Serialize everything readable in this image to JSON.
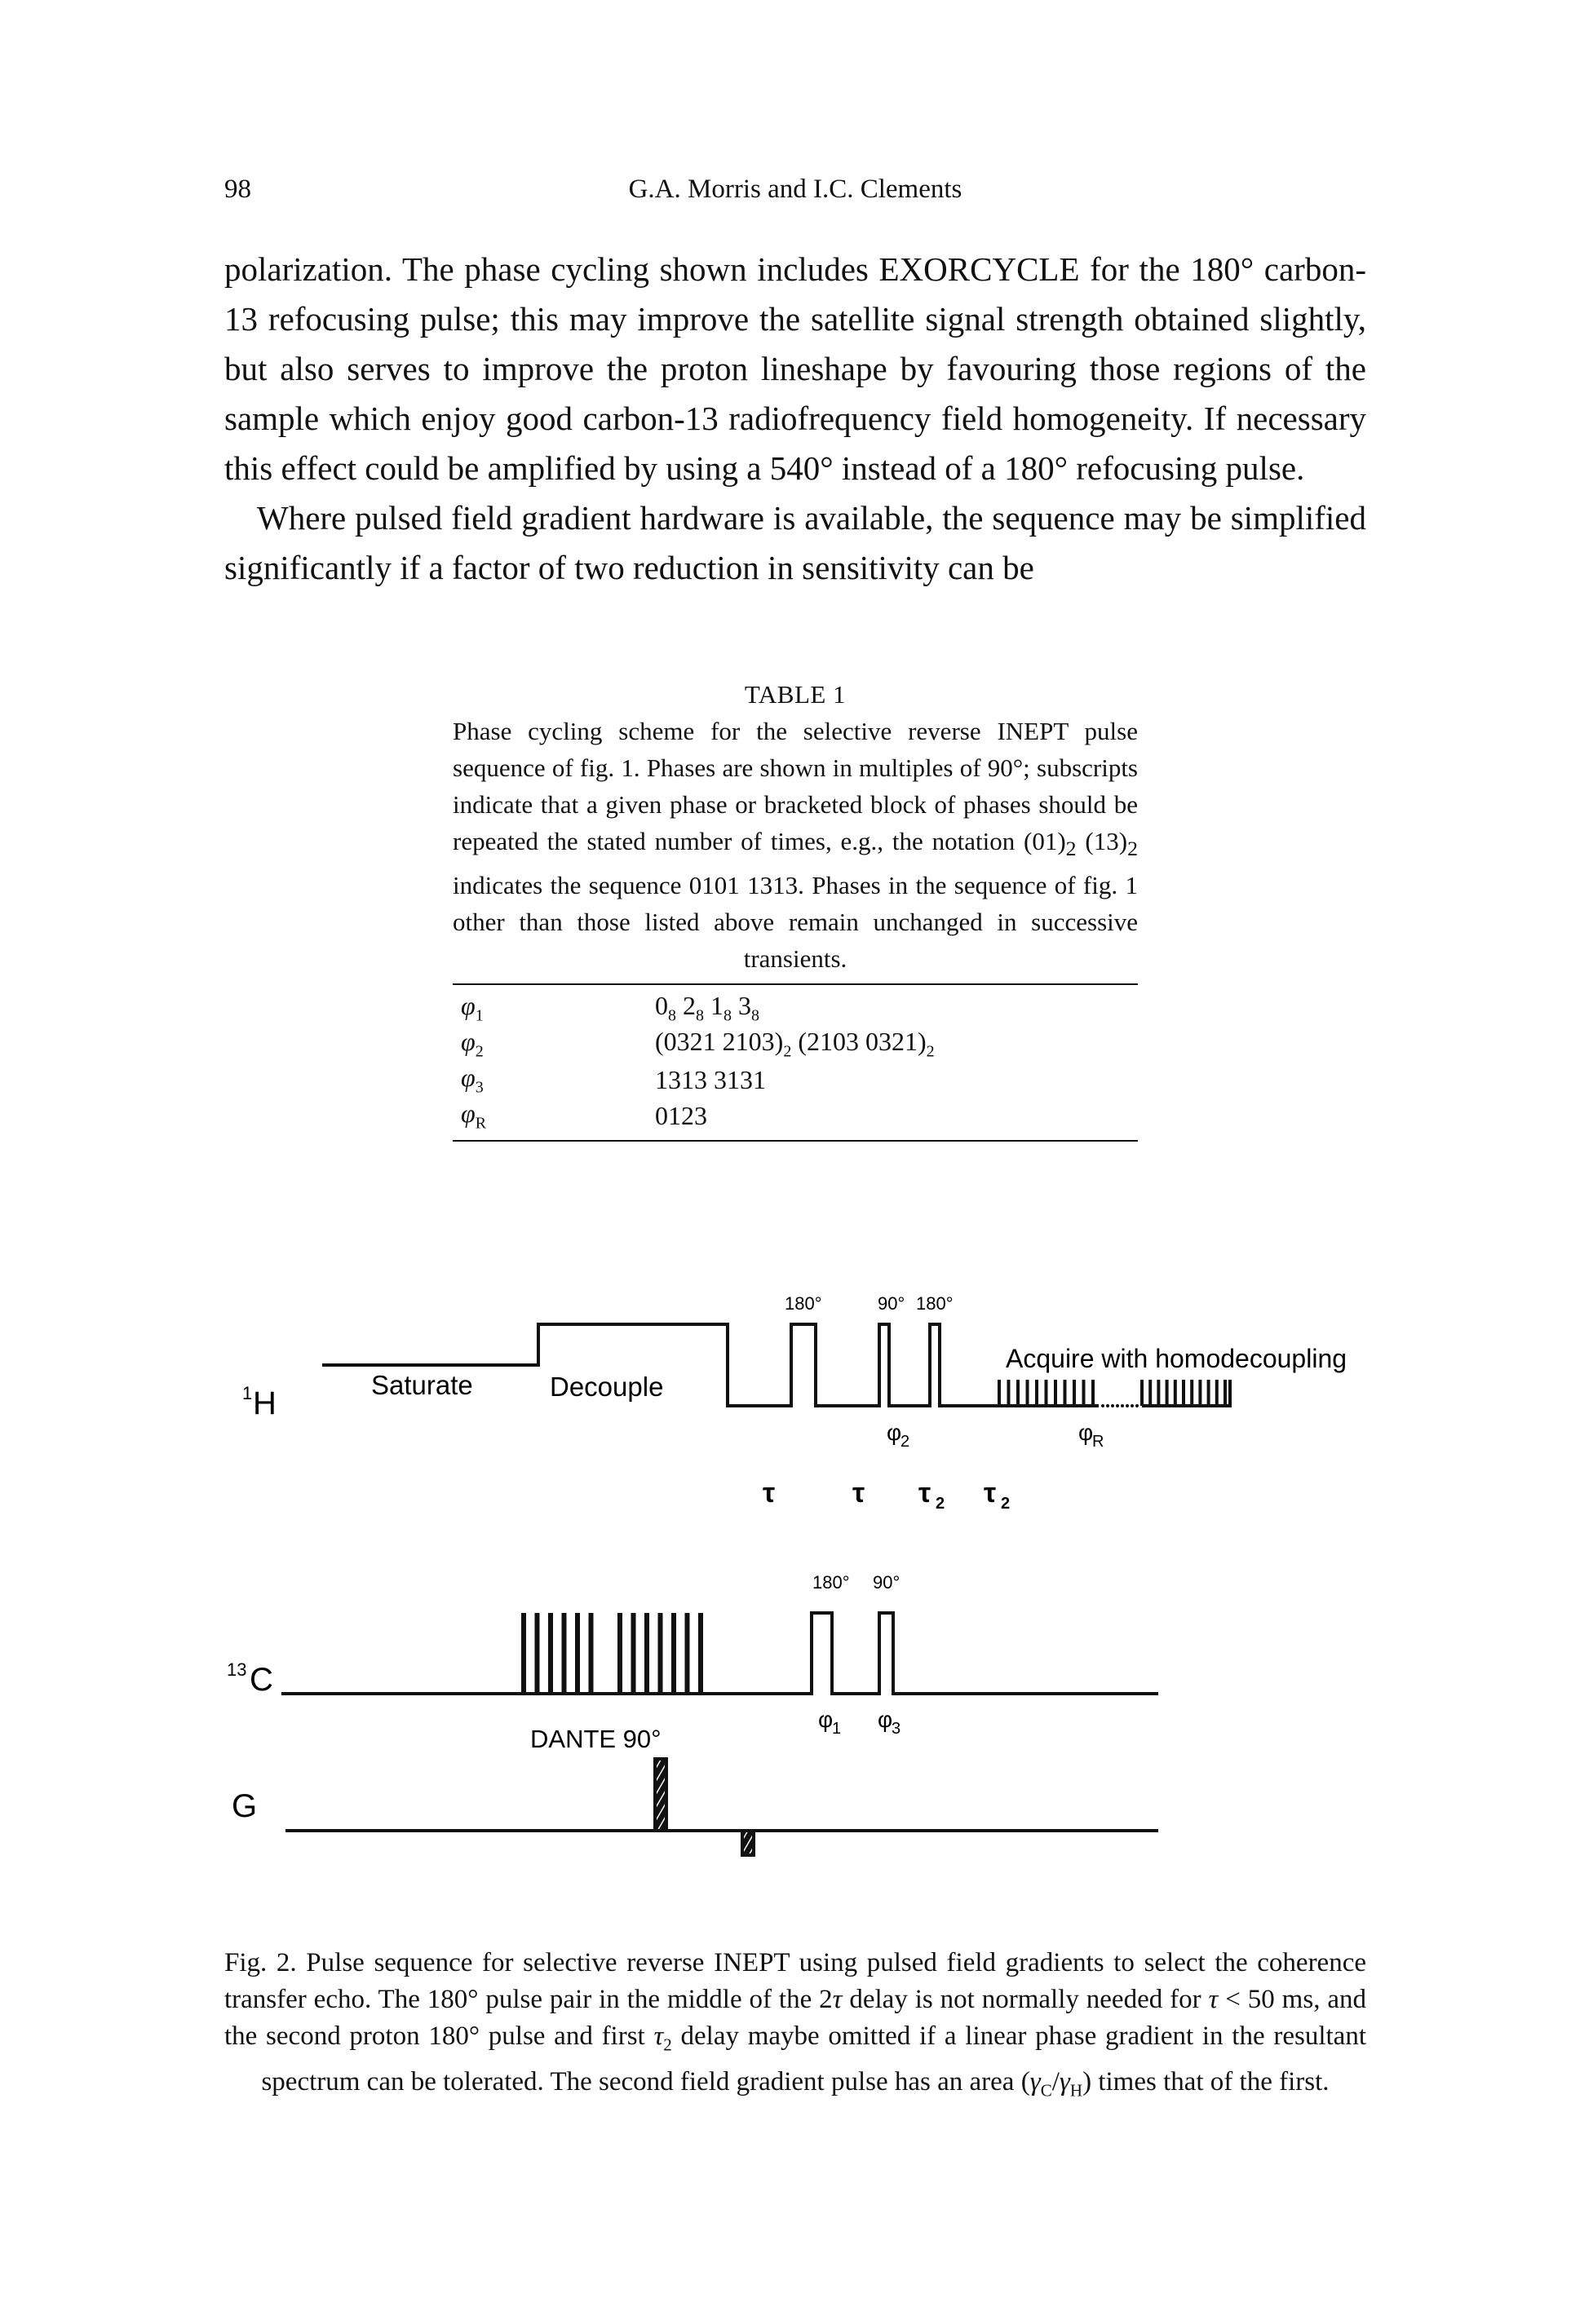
{
  "running_head": {
    "page_number": "98",
    "authors": "G.A. Morris and I.C. Clements"
  },
  "body_paragraphs": [
    "polarization. The phase cycling shown includes EXORCYCLE for the 180° carbon-13 refocusing pulse; this may improve the satellite signal strength obtained slightly, but also serves to improve the proton lineshape by favouring those regions of the sample which enjoy good carbon-13 radiofrequency field homogeneity. If necessary this effect could be amplified by using a 540° instead of a 180° refocusing pulse.",
    "Where pulsed field gradient hardware is available, the sequence may be simplified significantly if a factor of two reduction in sensitivity can be"
  ],
  "table": {
    "title": "TABLE 1",
    "caption_parts": {
      "a": "Phase cycling scheme for the selective reverse INEPT pulse sequence of fig. 1. Phases are shown in multiples of 90°; subscripts indicate that a given phase or bracketed block of phases should be repeated the stated number of times, e.g., the notation (01)",
      "sub1": "2",
      "b": " (13)",
      "sub2": "2",
      "c": " indicates the sequence 0101 1313. Phases in the sequence of fig. 1 other than those listed above remain unchanged in successive transients."
    },
    "rows": [
      {
        "symbol": "φ",
        "symbol_sub": "1",
        "value_html_parts": [
          [
            "0",
            "8"
          ],
          [
            " 2",
            "8"
          ],
          [
            " 1",
            "8"
          ],
          [
            " 3",
            "8"
          ]
        ]
      },
      {
        "symbol": "φ",
        "symbol_sub": "2",
        "value_html_parts": [
          [
            "(0321 2103)",
            "2"
          ],
          [
            " (2103 0321)",
            "2"
          ]
        ]
      },
      {
        "symbol": "φ",
        "symbol_sub": "3",
        "value_html_parts": [
          [
            "1313 3131",
            ""
          ]
        ]
      },
      {
        "symbol": "φ",
        "symbol_sub": "R",
        "value_html_parts": [
          [
            "0123",
            ""
          ]
        ]
      }
    ]
  },
  "diagram": {
    "channels": {
      "h1": {
        "sup": "1",
        "label": "H"
      },
      "c13": {
        "sup": "13",
        "label": "C"
      },
      "g": {
        "label": "G"
      }
    },
    "h_labels": {
      "saturate": "Saturate",
      "decouple": "Decouple",
      "pulse_180_a": "180°",
      "pulse_90": "90°",
      "pulse_180_b": "180°",
      "acquire": "Acquire with homodecoupling",
      "phase2": "φ",
      "phase2_sub": "2",
      "phaseR": "φ",
      "phaseR_sub": "R"
    },
    "delays": [
      {
        "symbol": "τ",
        "sub": ""
      },
      {
        "symbol": "τ",
        "sub": ""
      },
      {
        "symbol": "τ",
        "sub": "2"
      },
      {
        "symbol": "τ",
        "sub": "2"
      }
    ],
    "c_labels": {
      "pulse_180": "180°",
      "pulse_90": "90°",
      "dante": "DANTE 90°",
      "phase1": "φ",
      "phase1_sub": "1",
      "phase3": "φ",
      "phase3_sub": "3"
    },
    "gradient_area_ratio_label": "(γC/γH)"
  },
  "figure_caption": {
    "parts": {
      "a": "Fig. 2. Pulse sequence for selective reverse INEPT using pulsed field gradients to select the coherence transfer echo. The 180° pulse pair in the middle of the 2",
      "tau1": "τ",
      "b": " delay is not normally needed for ",
      "tau2": "τ",
      "c": " < 50 ms, and the second proton 180° pulse and first ",
      "tau3": "τ",
      "tau3_sub": "2",
      "d": " delay maybe omitted if a linear phase gradient in the resultant spectrum can be tolerated. The second field gradient pulse has an area (",
      "gc": "γ",
      "gc_sub": "C",
      "slash": "/",
      "gh": "γ",
      "gh_sub": "H",
      "e": ") times that of the first."
    }
  }
}
